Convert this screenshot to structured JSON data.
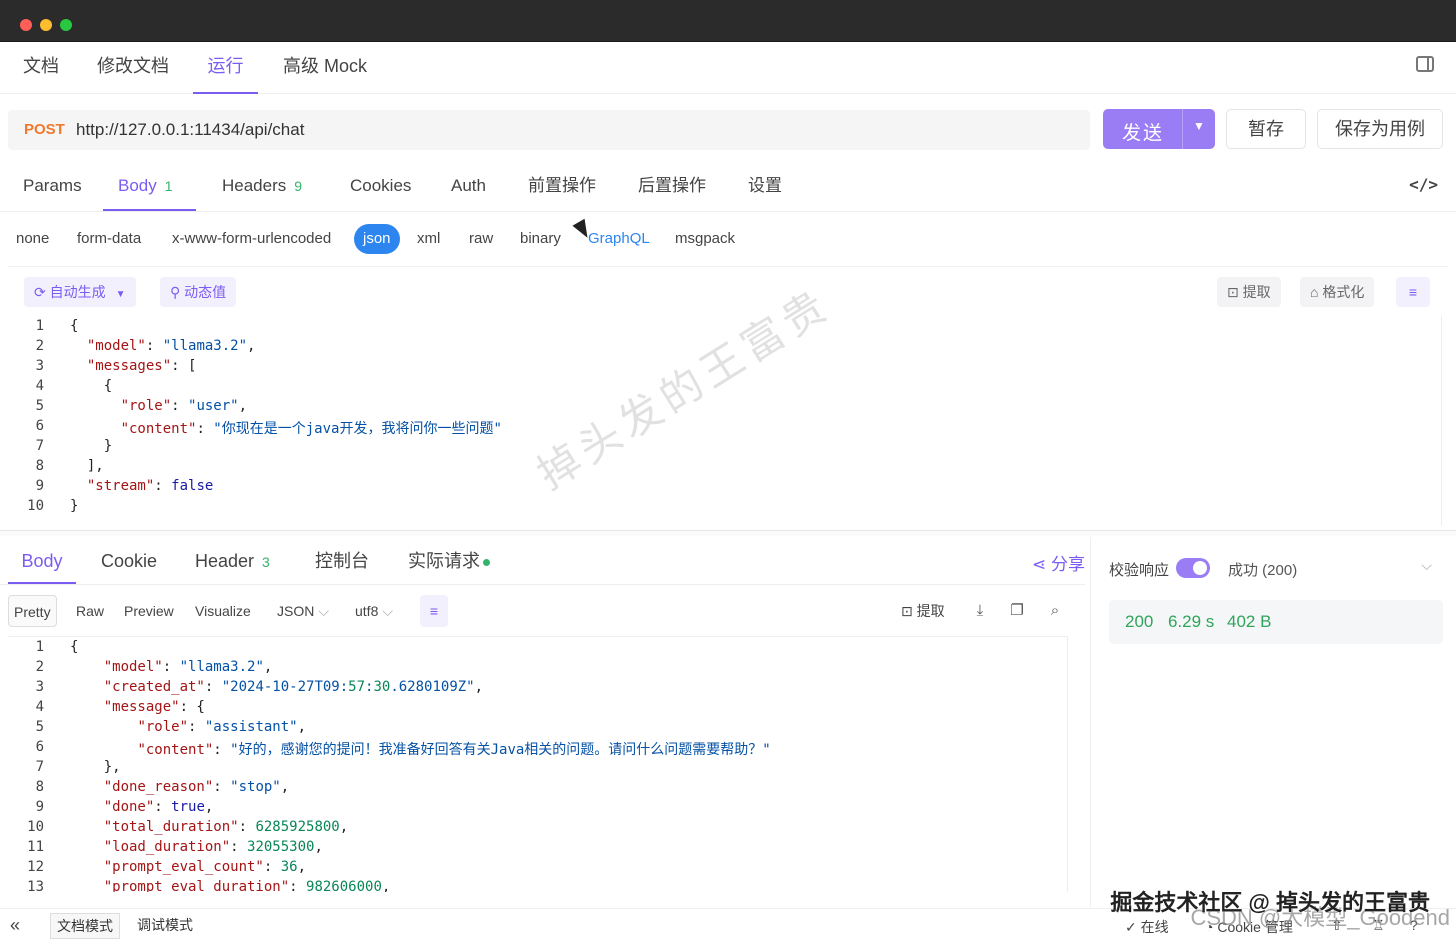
{
  "top_tabs": [
    "文档",
    "修改文档",
    "运行",
    "高级 Mock"
  ],
  "request": {
    "method": "POST",
    "url": "http://127.0.0.1:11434/api/chat",
    "send_label": "发送",
    "save_temp_label": "暂存",
    "save_case_label": "保存为用例"
  },
  "req_tabs": [
    {
      "label": "Params"
    },
    {
      "label": "Body",
      "badge": "1"
    },
    {
      "label": "Headers",
      "badge": "9"
    },
    {
      "label": "Cookies"
    },
    {
      "label": "Auth"
    },
    {
      "label": "前置操作"
    },
    {
      "label": "后置操作"
    },
    {
      "label": "设置"
    }
  ],
  "body_types": [
    "none",
    "form-data",
    "x-www-form-urlencoded",
    "json",
    "xml",
    "raw",
    "binary",
    "GraphQL",
    "msgpack"
  ],
  "editor_toolbar": {
    "auto_gen": "自动生成",
    "dynamic": "动态值",
    "extract": "提取",
    "format": "格式化"
  },
  "request_body_lines": [
    "{",
    "  \"model\": \"llama3.2\",",
    "  \"messages\": [",
    "    {",
    "      \"role\": \"user\",",
    "      \"content\": \"你现在是一个java开发，我将问你一些问题\"",
    "    }",
    "  ],",
    "  \"stream\": false",
    "}"
  ],
  "res_tabs": [
    {
      "label": "Body"
    },
    {
      "label": "Cookie"
    },
    {
      "label": "Header",
      "badge": "3"
    },
    {
      "label": "控制台"
    },
    {
      "label": "实际请求"
    }
  ],
  "share_label": "分享",
  "res_toolbar": {
    "views": [
      "Pretty",
      "Raw",
      "Preview",
      "Visualize"
    ],
    "format": "JSON",
    "encoding": "utf8",
    "extract": "提取"
  },
  "response_lines": [
    "{",
    "    \"model\": \"llama3.2\",",
    "    \"created_at\": \"2024-10-27T09:57:30.6280109Z\",",
    "    \"message\": {",
    "        \"role\": \"assistant\",",
    "        \"content\": \"好的，感谢您的提问！我准备好回答有关Java相关的问题。请问什么问题需要帮助？\"",
    "    },",
    "    \"done_reason\": \"stop\",",
    "    \"done\": true,",
    "    \"total_duration\": 6285925800,",
    "    \"load_duration\": 32055300,",
    "    \"prompt_eval_count\": 36,",
    "    \"prompt_eval_duration\": 982606000,"
  ],
  "validation": {
    "label": "校验响应",
    "result": "成功 (200)"
  },
  "status": {
    "code": "200",
    "time": "6.29 s",
    "size": "402 B"
  },
  "bottom": {
    "doc_mode": "文档模式",
    "debug_mode": "调试模式",
    "online": "在线",
    "cookie_mgmt": "Cookie 管理"
  },
  "watermark": "掉头发的王富贵",
  "corner_watermark": "掘金技术社区 @ 掉头发的王富贵",
  "corner_watermark2": "CSDN @大模型_Goodend"
}
